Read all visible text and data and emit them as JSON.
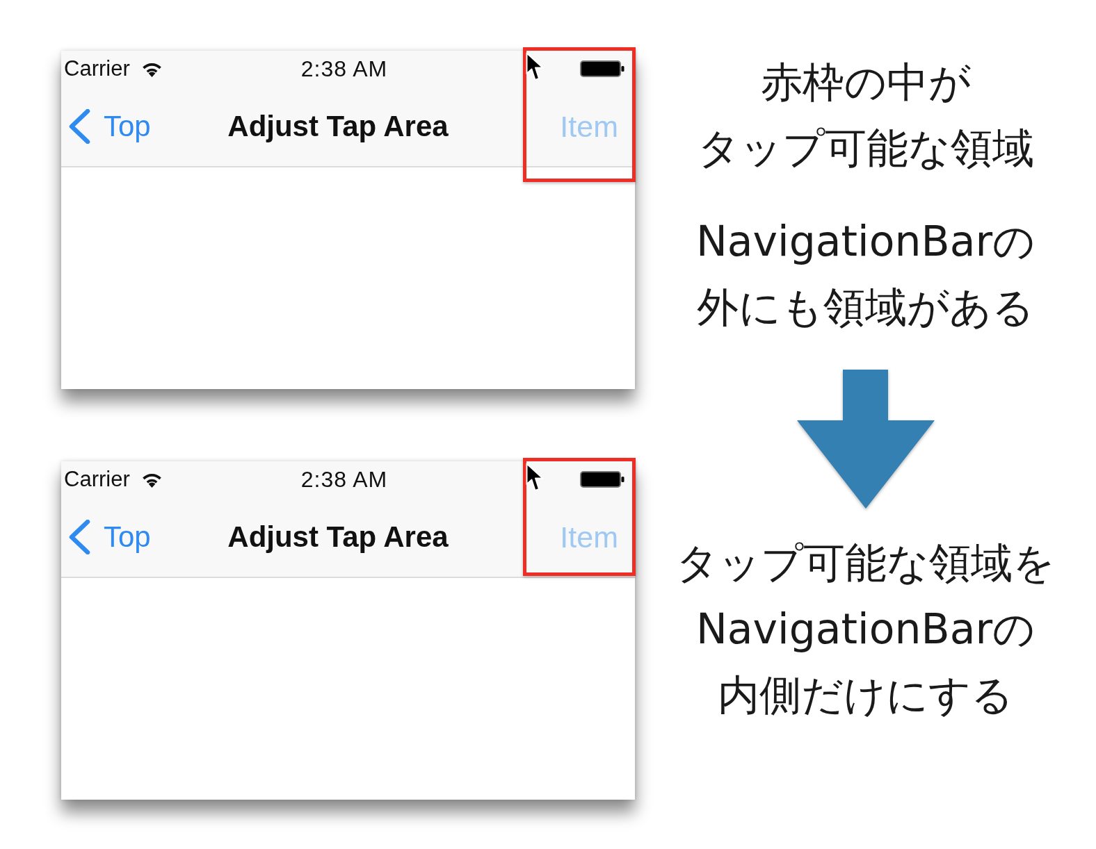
{
  "panels": [
    {
      "status_bar": {
        "carrier": "Carrier",
        "time": "2:38 AM"
      },
      "nav_bar": {
        "back_label": "Top",
        "title": "Adjust Tap Area",
        "right_item": {
          "label": "Item",
          "pressed": true
        }
      },
      "tap_area": {
        "kind": "beyond_bar"
      }
    },
    {
      "status_bar": {
        "carrier": "Carrier",
        "time": "2:38 AM"
      },
      "nav_bar": {
        "back_label": "Top",
        "title": "Adjust Tap Area",
        "right_item": {
          "label": "Item",
          "pressed": true
        }
      },
      "tap_area": {
        "kind": "within_bar"
      }
    }
  ],
  "explanation": {
    "problem": [
      {
        "lines": [
          "赤枠の中が",
          "タップ可能な領域"
        ]
      },
      {
        "lines": [
          "NavigationBarの",
          "外にも領域がある"
        ]
      }
    ],
    "fix": [
      {
        "lines": [
          "タップ可能な領域を",
          "NavigationBarの",
          "内側だけにする"
        ]
      }
    ]
  }
}
